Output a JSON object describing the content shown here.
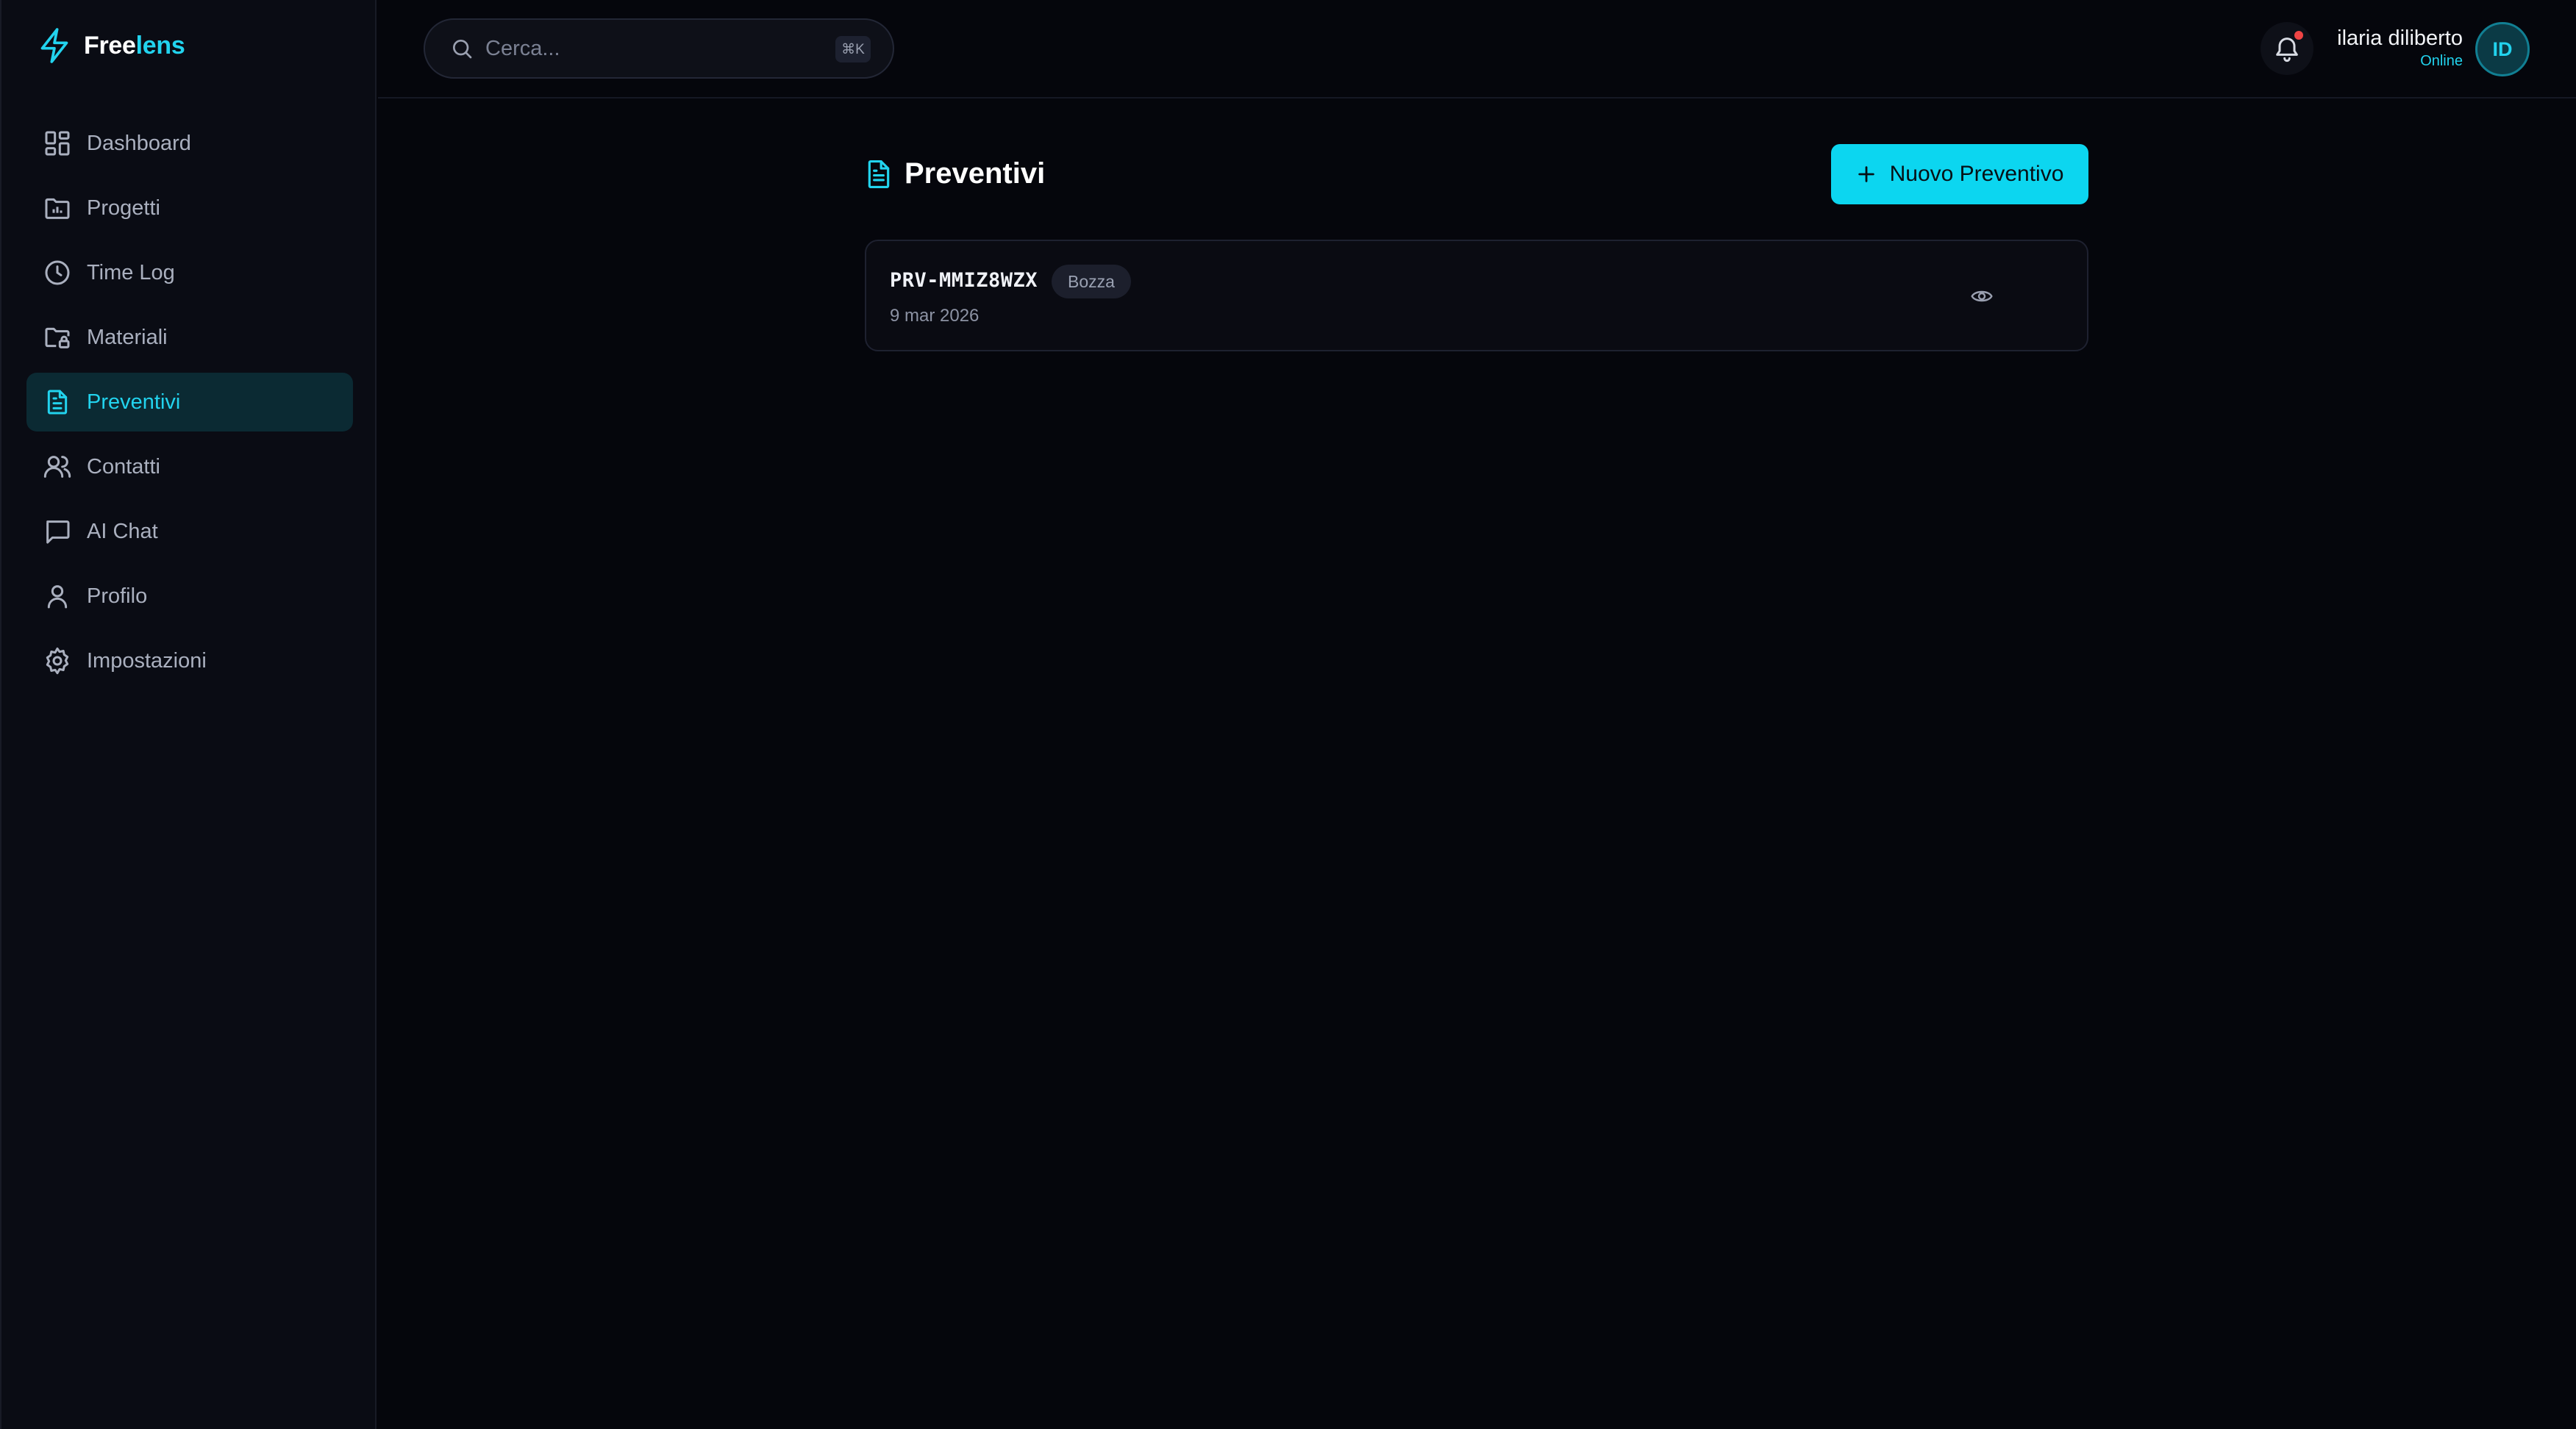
{
  "brand": {
    "name_part1": "Free",
    "name_part2": "lens",
    "accent_color": "#22d3ee"
  },
  "sidebar": {
    "items": [
      {
        "label": "Dashboard",
        "icon": "dashboard-icon",
        "active": false
      },
      {
        "label": "Progetti",
        "icon": "folder-chart-icon",
        "active": false
      },
      {
        "label": "Time Log",
        "icon": "clock-icon",
        "active": false
      },
      {
        "label": "Materiali",
        "icon": "folder-lock-icon",
        "active": false
      },
      {
        "label": "Preventivi",
        "icon": "document-icon",
        "active": true
      },
      {
        "label": "Contatti",
        "icon": "users-icon",
        "active": false
      },
      {
        "label": "AI Chat",
        "icon": "chat-icon",
        "active": false
      },
      {
        "label": "Profilo",
        "icon": "user-icon",
        "active": false
      },
      {
        "label": "Impostazioni",
        "icon": "gear-icon",
        "active": false
      }
    ]
  },
  "topbar": {
    "search_placeholder": "Cerca...",
    "search_shortcut": "⌘K",
    "notifications_unread": true,
    "user": {
      "name": "ilaria diliberto",
      "status": "Online",
      "initials": "ID"
    }
  },
  "main": {
    "title": "Preventivi",
    "new_button_label": "Nuovo Preventivo",
    "quotes": [
      {
        "code": "PRV-MMIZ8WZX",
        "status": "Bozza",
        "date": "9 mar 2026"
      }
    ]
  }
}
